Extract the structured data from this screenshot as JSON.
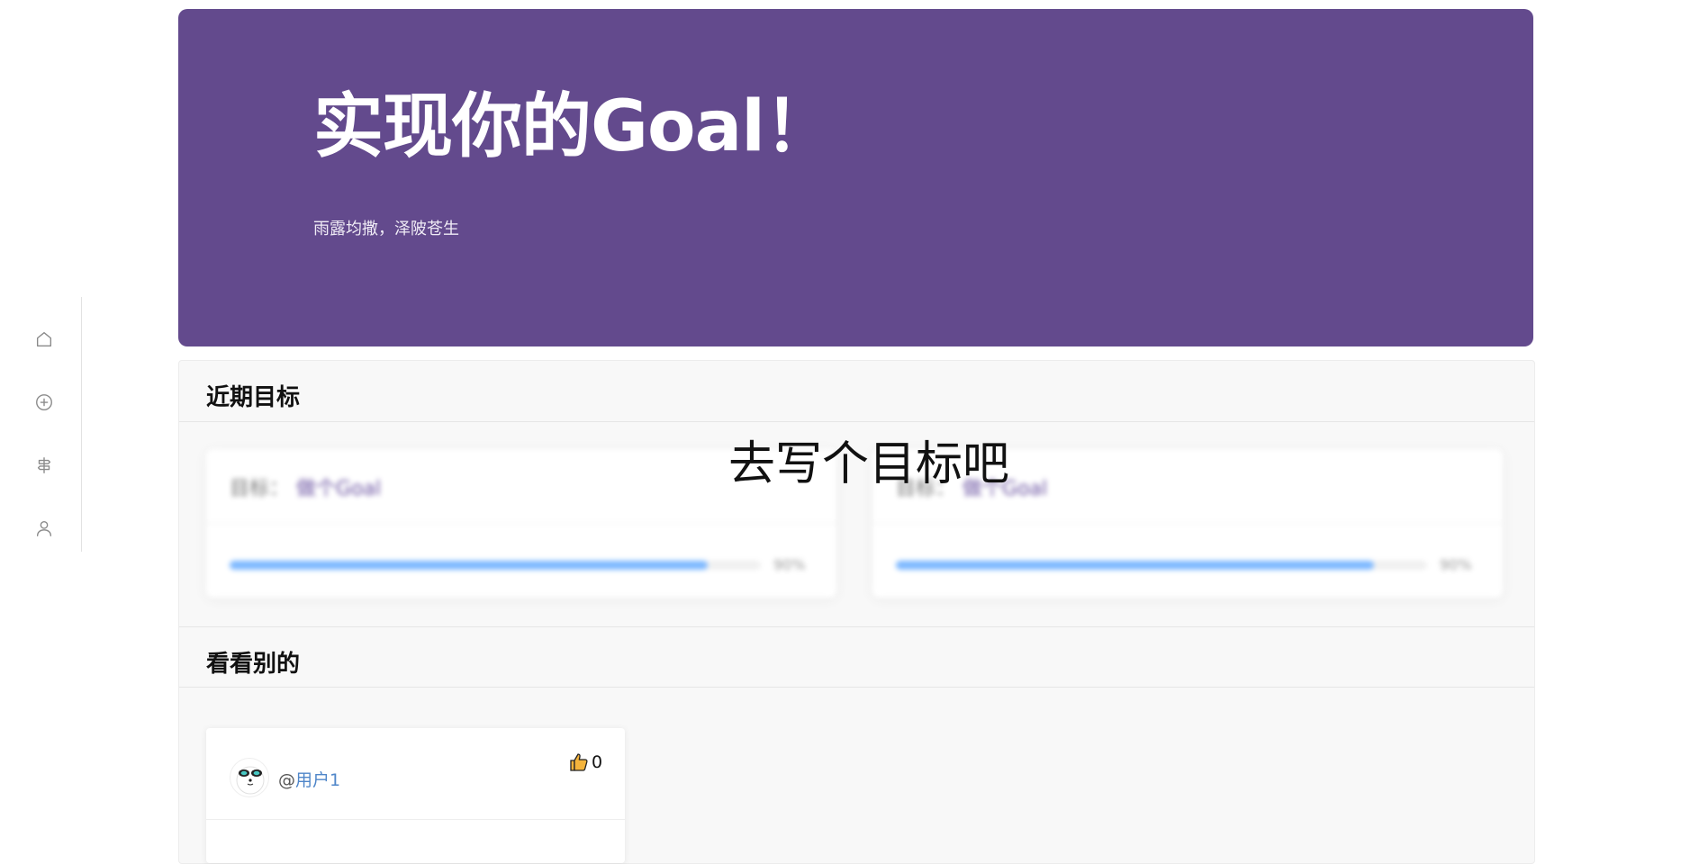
{
  "hero": {
    "title": "实现你的Goal！",
    "subtitle": "雨露均撒，泽陂苍生"
  },
  "nav": {
    "items": [
      {
        "icon": "home-icon"
      },
      {
        "icon": "plus-circle-icon"
      },
      {
        "icon": "signpost-icon"
      },
      {
        "icon": "user-icon"
      }
    ]
  },
  "recent_goals": {
    "title": "近期目标",
    "empty_prompt": "去写个目标吧",
    "cards": [
      {
        "label": "目标：",
        "value": "做个Goal",
        "progress_percent": 90,
        "progress_text": "90%"
      },
      {
        "label": "目标：",
        "value": "做个Goal",
        "progress_percent": 90,
        "progress_text": "90%"
      }
    ]
  },
  "others": {
    "title": "看看别的",
    "posts": [
      {
        "at": "@",
        "username": "用户1",
        "likes": "0"
      }
    ]
  },
  "colors": {
    "hero_bg": "#634a8d",
    "progress": "#7db8ff",
    "link": "#4f86c9"
  }
}
